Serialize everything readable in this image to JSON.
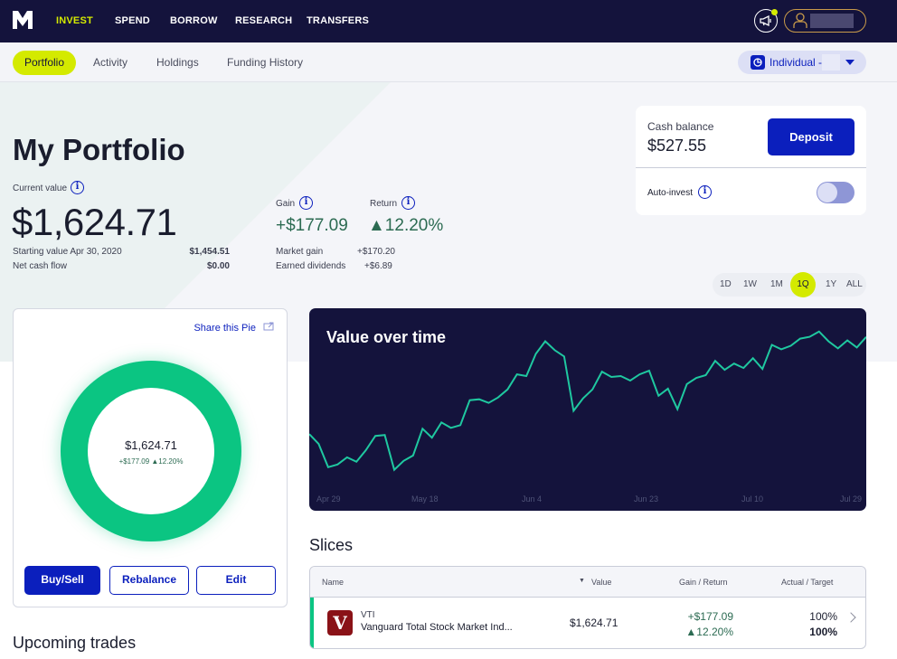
{
  "topnav": {
    "logo": "M",
    "items": [
      {
        "label": "INVEST",
        "active": true
      },
      {
        "label": "SPEND"
      },
      {
        "label": "BORROW"
      },
      {
        "label": "RESEARCH"
      },
      {
        "label": "TRANSFERS"
      }
    ],
    "announcement_icon": "megaphone-icon",
    "profile_icon": "user-icon"
  },
  "subnav": {
    "tabs": [
      {
        "label": "Portfolio",
        "active": true
      },
      {
        "label": "Activity"
      },
      {
        "label": "Holdings"
      },
      {
        "label": "Funding History"
      }
    ],
    "account_selector": "Individual -"
  },
  "portfolio": {
    "title": "My Portfolio",
    "current_value_label": "Current value",
    "current_value": "$1,624.71",
    "starting_value_label": "Starting value Apr 30, 2020",
    "starting_value": "$1,454.51",
    "net_cash_flow_label": "Net cash flow",
    "net_cash_flow": "$0.00",
    "gain_label": "Gain",
    "gain": "+$177.09",
    "return_label": "Return",
    "return": "▲12.20%",
    "market_gain_label": "Market gain",
    "market_gain": "+$170.20",
    "earned_dividends_label": "Earned dividends",
    "earned_dividends": "+$6.89"
  },
  "cash": {
    "label": "Cash balance",
    "value": "$527.55",
    "deposit_label": "Deposit",
    "auto_invest_label": "Auto-invest",
    "auto_invest_on": false
  },
  "ranges": {
    "items": [
      "1D",
      "1W",
      "1M",
      "1Q",
      "1Y",
      "ALL"
    ],
    "selected": "1Q"
  },
  "pie": {
    "share_label": "Share this Pie",
    "center_value": "$1,624.71",
    "center_gain": "+$177.09 ▲12.20%",
    "buy_sell_label": "Buy/Sell",
    "rebalance_label": "Rebalance",
    "edit_label": "Edit",
    "color": "#0bc582"
  },
  "upcoming_trades_title": "Upcoming trades",
  "chart_data": {
    "type": "line",
    "title": "Value over time",
    "xlabel": "",
    "ylabel": "",
    "x_tick_labels": [
      "Apr 29",
      "May 18",
      "Jun 4",
      "Jun 23",
      "Jul 10",
      "Jul 29"
    ],
    "grid": false,
    "line_color": "#1fc8a0",
    "series": [
      {
        "name": "Portfolio value",
        "values": [
          1454.5,
          1437.3,
          1396.7,
          1401.4,
          1413.9,
          1406.1,
          1426.4,
          1451.4,
          1453.0,
          1392.1,
          1407.7,
          1417.1,
          1463.9,
          1448.3,
          1474.9,
          1465.5,
          1470.2,
          1513.9,
          1515.5,
          1509.2,
          1518.6,
          1532.7,
          1559.2,
          1556.1,
          1595.1,
          1617.0,
          1601.4,
          1590.4,
          1495.2,
          1517.0,
          1532.7,
          1563.9,
          1554.5,
          1556.1,
          1548.3,
          1559.2,
          1565.5,
          1521.7,
          1534.2,
          1498.3,
          1542.1,
          1553.0,
          1557.7,
          1582.7,
          1567.0,
          1578.0,
          1570.2,
          1587.4,
          1568.6,
          1610.8,
          1603.0,
          1609.2,
          1621.7,
          1624.8,
          1634.2,
          1617.0,
          1604.5,
          1618.6,
          1606.1,
          1624.7
        ]
      }
    ]
  },
  "slices": {
    "title": "Slices",
    "columns": [
      "Name",
      "Value",
      "Gain / Return",
      "Actual / Target"
    ],
    "sorted_column": "Value",
    "rows": [
      {
        "ticker": "VTI",
        "name": "Vanguard Total Stock Market Ind...",
        "logo_letter": "V",
        "value": "$1,624.71",
        "gain": "+$177.09",
        "return": "▲12.20%",
        "actual": "100%",
        "target": "100%"
      }
    ]
  }
}
